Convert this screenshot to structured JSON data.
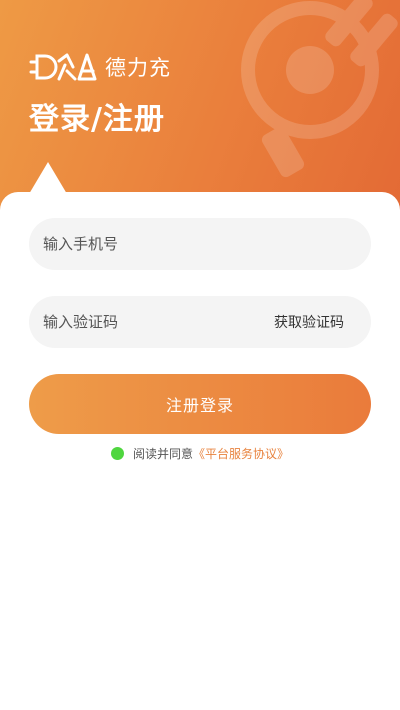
{
  "brand": {
    "logo_icon": "brand-logo-icon",
    "name": "德力充"
  },
  "header": {
    "title": "登录/注册"
  },
  "form": {
    "phone_placeholder": "输入手机号",
    "code_placeholder": "输入验证码",
    "get_code_label": "获取验证码",
    "submit_label": "注册登录"
  },
  "agreement": {
    "text": "阅读并同意",
    "link": "《平台服务协议》",
    "checked": true
  },
  "colors": {
    "accent": "#ea7f3c",
    "accent_light": "#ee9a45",
    "check": "#4fd63f",
    "link": "#e8833e"
  }
}
